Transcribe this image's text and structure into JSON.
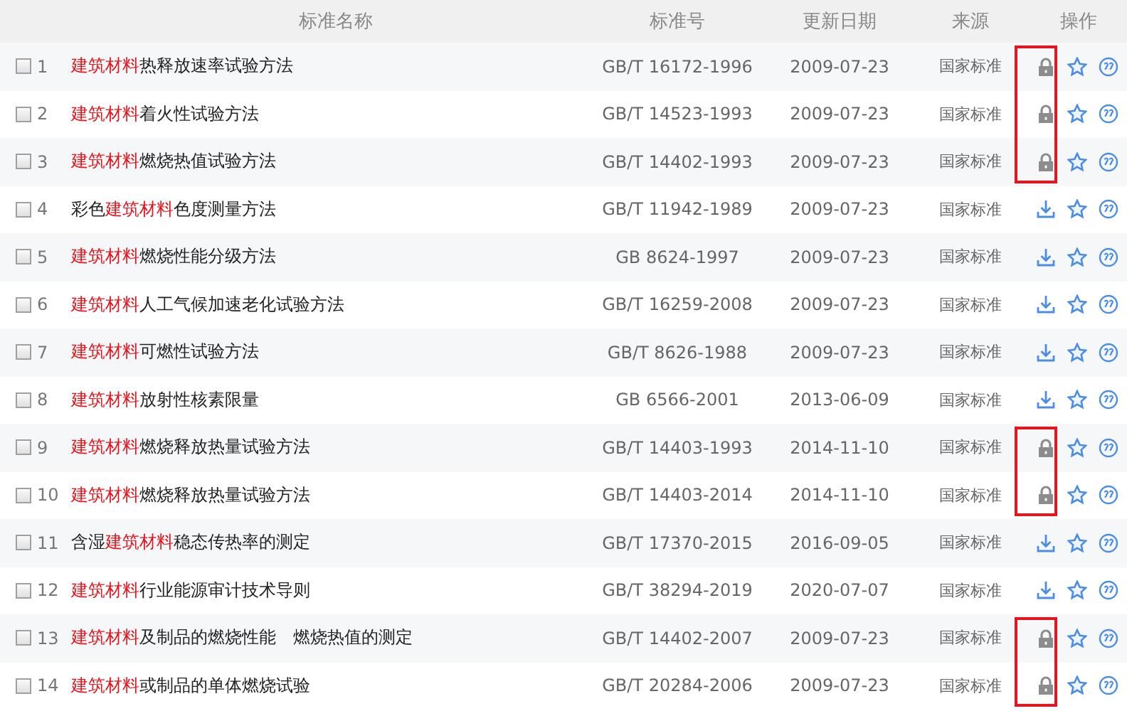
{
  "table": {
    "columns": [
      "标准名称",
      "标准号",
      "更新日期",
      "来源",
      "操作"
    ],
    "rows": [
      {
        "checked": false,
        "number": "1",
        "name": [
          {
            "text": "建筑材料",
            "hit": true
          },
          {
            "text": "热释放速率试验方法",
            "hit": false
          }
        ],
        "code": "GB/T 16172-1996",
        "date": "2009-07-23",
        "source": "国家标准",
        "kind": "lock",
        "highlighted": true
      },
      {
        "checked": false,
        "number": "2",
        "name": [
          {
            "text": "建筑材料",
            "hit": true
          },
          {
            "text": "着火性试验方法",
            "hit": false
          }
        ],
        "code": "GB/T 14523-1993",
        "date": "2009-07-23",
        "source": "国家标准",
        "kind": "lock",
        "highlighted": true
      },
      {
        "checked": false,
        "number": "3",
        "name": [
          {
            "text": "建筑材料",
            "hit": true
          },
          {
            "text": "燃烧热值试验方法",
            "hit": false
          }
        ],
        "code": "GB/T 14402-1993",
        "date": "2009-07-23",
        "source": "国家标准",
        "kind": "lock",
        "highlighted": true
      },
      {
        "checked": false,
        "number": "4",
        "name": [
          {
            "text": "彩色",
            "hit": false
          },
          {
            "text": "建筑材料",
            "hit": true
          },
          {
            "text": "色度测量方法",
            "hit": false
          }
        ],
        "code": "GB/T 11942-1989",
        "date": "2009-07-23",
        "source": "国家标准",
        "kind": "download",
        "highlighted": false
      },
      {
        "checked": false,
        "number": "5",
        "name": [
          {
            "text": "建筑材料",
            "hit": true
          },
          {
            "text": "燃烧性能分级方法",
            "hit": false
          }
        ],
        "code": "GB 8624-1997",
        "date": "2009-07-23",
        "source": "国家标准",
        "kind": "download",
        "highlighted": false
      },
      {
        "checked": false,
        "number": "6",
        "name": [
          {
            "text": "建筑材料",
            "hit": true
          },
          {
            "text": "人工气候加速老化试验方法",
            "hit": false
          }
        ],
        "code": "GB/T 16259-2008",
        "date": "2009-07-23",
        "source": "国家标准",
        "kind": "download",
        "highlighted": false
      },
      {
        "checked": false,
        "number": "7",
        "name": [
          {
            "text": "建筑材料",
            "hit": true
          },
          {
            "text": "可燃性试验方法",
            "hit": false
          }
        ],
        "code": "GB/T 8626-1988",
        "date": "2009-07-23",
        "source": "国家标准",
        "kind": "download",
        "highlighted": false
      },
      {
        "checked": false,
        "number": "8",
        "name": [
          {
            "text": "建筑材料",
            "hit": true
          },
          {
            "text": "放射性核素限量",
            "hit": false
          }
        ],
        "code": "GB 6566-2001",
        "date": "2013-06-09",
        "source": "国家标准",
        "kind": "download",
        "highlighted": false
      },
      {
        "checked": false,
        "number": "9",
        "name": [
          {
            "text": "建筑材料",
            "hit": true
          },
          {
            "text": "燃烧释放热量试验方法",
            "hit": false
          }
        ],
        "code": "GB/T 14403-1993",
        "date": "2014-11-10",
        "source": "国家标准",
        "kind": "lock",
        "highlighted": true
      },
      {
        "checked": false,
        "number": "10",
        "name": [
          {
            "text": "建筑材料",
            "hit": true
          },
          {
            "text": "燃烧释放热量试验方法",
            "hit": false
          }
        ],
        "code": "GB/T 14403-2014",
        "date": "2014-11-10",
        "source": "国家标准",
        "kind": "lock",
        "highlighted": true
      },
      {
        "checked": false,
        "number": "11",
        "name": [
          {
            "text": "含湿",
            "hit": false
          },
          {
            "text": "建筑材料",
            "hit": true
          },
          {
            "text": "稳态传热率的测定",
            "hit": false
          }
        ],
        "code": "GB/T 17370-2015",
        "date": "2016-09-05",
        "source": "国家标准",
        "kind": "download",
        "highlighted": false
      },
      {
        "checked": false,
        "number": "12",
        "name": [
          {
            "text": "建筑材料",
            "hit": true
          },
          {
            "text": "行业能源审计技术导则",
            "hit": false
          }
        ],
        "code": "GB/T 38294-2019",
        "date": "2020-07-07",
        "source": "国家标准",
        "kind": "download",
        "highlighted": false
      },
      {
        "checked": false,
        "number": "13",
        "name": [
          {
            "text": "建筑材料",
            "hit": true
          },
          {
            "text": "及制品的燃烧性能　燃烧热值的测定",
            "hit": false
          }
        ],
        "code": "GB/T 14402-2007",
        "date": "2009-07-23",
        "source": "国家标准",
        "kind": "lock",
        "highlighted": true
      },
      {
        "checked": false,
        "number": "14",
        "name": [
          {
            "text": "建筑材料",
            "hit": true
          },
          {
            "text": "或制品的单体燃烧试验",
            "hit": false
          }
        ],
        "code": "GB/T 20284-2006",
        "date": "2009-07-23",
        "source": "国家标准",
        "kind": "lock",
        "highlighted": true
      }
    ]
  }
}
